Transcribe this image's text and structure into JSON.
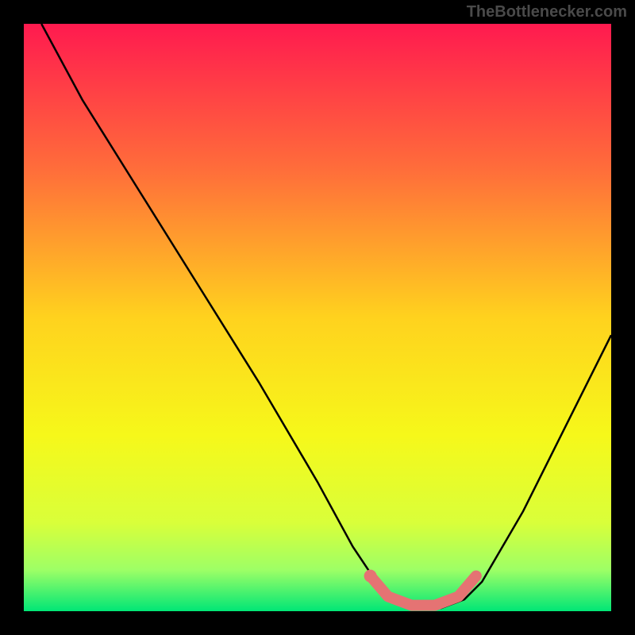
{
  "watermark": "TheBottlenecker.com",
  "chart_data": {
    "type": "line",
    "title": "",
    "xlabel": "",
    "ylabel": "",
    "xlim": [
      0,
      100
    ],
    "ylim": [
      0,
      100
    ],
    "background_gradient": {
      "stops": [
        {
          "offset": 0,
          "color": "#ff1a4f"
        },
        {
          "offset": 25,
          "color": "#ff6e3a"
        },
        {
          "offset": 50,
          "color": "#ffd21e"
        },
        {
          "offset": 70,
          "color": "#f6f81a"
        },
        {
          "offset": 85,
          "color": "#d9ff3a"
        },
        {
          "offset": 93,
          "color": "#9dff66"
        },
        {
          "offset": 100,
          "color": "#00e676"
        }
      ]
    },
    "curve": [
      {
        "x": 3,
        "y": 100
      },
      {
        "x": 10,
        "y": 87
      },
      {
        "x": 20,
        "y": 71
      },
      {
        "x": 30,
        "y": 55
      },
      {
        "x": 40,
        "y": 39
      },
      {
        "x": 50,
        "y": 22
      },
      {
        "x": 56,
        "y": 11
      },
      {
        "x": 60,
        "y": 5
      },
      {
        "x": 63,
        "y": 2
      },
      {
        "x": 67,
        "y": 0.5
      },
      {
        "x": 71,
        "y": 0.5
      },
      {
        "x": 75,
        "y": 2
      },
      {
        "x": 78,
        "y": 5
      },
      {
        "x": 85,
        "y": 17
      },
      {
        "x": 92,
        "y": 31
      },
      {
        "x": 100,
        "y": 47
      }
    ],
    "highlight_segment": {
      "color": "#e57373",
      "points": [
        {
          "x": 59,
          "y": 6
        },
        {
          "x": 62,
          "y": 2.5
        },
        {
          "x": 66,
          "y": 1
        },
        {
          "x": 70,
          "y": 1
        },
        {
          "x": 74,
          "y": 2.5
        },
        {
          "x": 77,
          "y": 6
        }
      ]
    },
    "highlight_dot": {
      "x": 59,
      "y": 6,
      "color": "#e57373"
    }
  }
}
